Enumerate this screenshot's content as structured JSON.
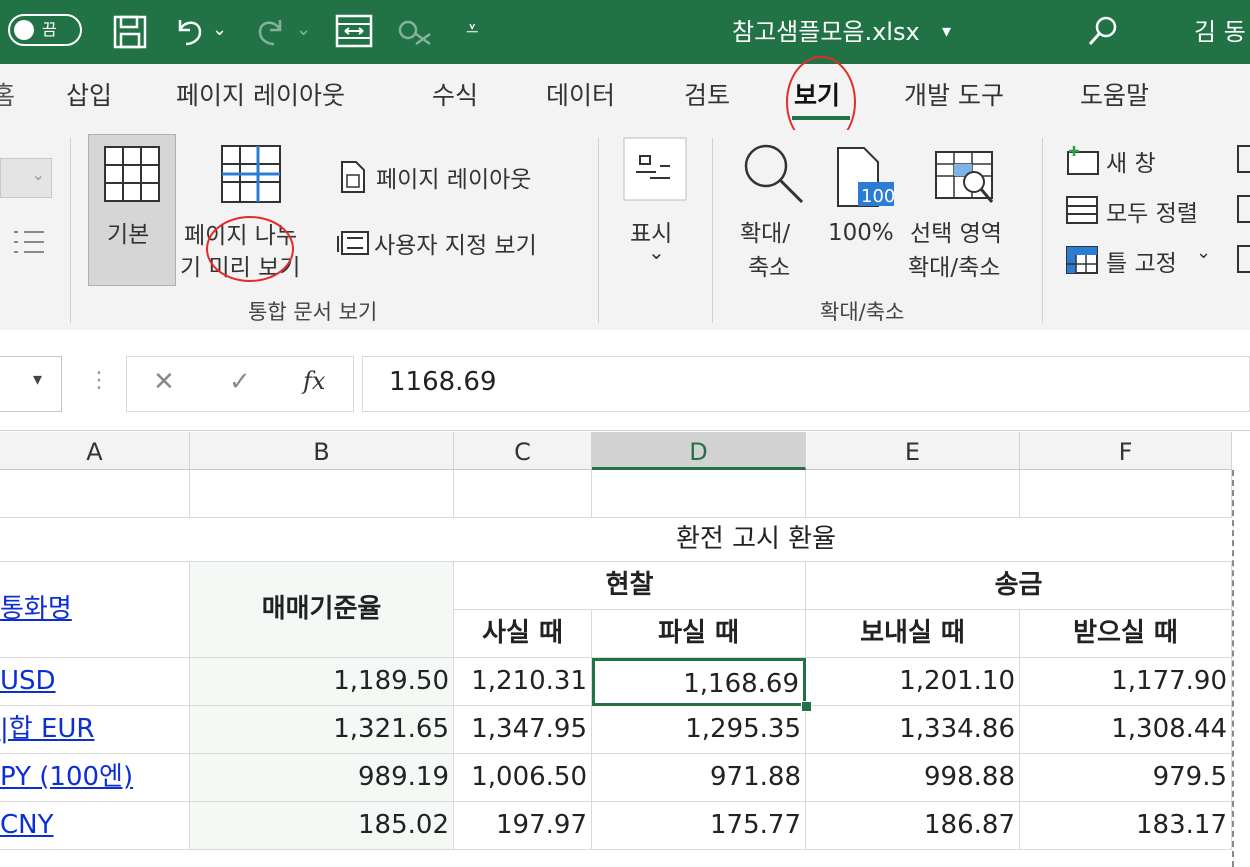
{
  "titlebar": {
    "autosave_label": "끔",
    "filename": "참고샘플모음.xlsx",
    "filename_caret": "▾",
    "user": "김 동"
  },
  "tabs": [
    {
      "label": "삽입"
    },
    {
      "label": "페이지 레이아웃"
    },
    {
      "label": "수식"
    },
    {
      "label": "데이터"
    },
    {
      "label": "검토"
    },
    {
      "label": "보기",
      "active": true
    },
    {
      "label": "개발 도구"
    },
    {
      "label": "도움말"
    }
  ],
  "ribbon": {
    "workbook_views": {
      "normal": "기본",
      "page_break_1": "페이지 나누",
      "page_break_2": "기 미리 보기",
      "page_layout": "페이지 레이아웃",
      "custom_views": "사용자 지정 보기",
      "group_label": "통합 문서 보기"
    },
    "show": {
      "label": "표시",
      "caret": "⌄"
    },
    "zoom": {
      "zoom_1": "확대/",
      "zoom_2": "축소",
      "zoom100": "100%",
      "zoom100_icon_text": "100",
      "selection_1": "선택 영역",
      "selection_2": "확대/축소",
      "group_label": "확대/축소"
    },
    "window": {
      "new_window": "새 창",
      "arrange_all": "모두 정렬",
      "freeze_panes": "틀 고정",
      "freeze_caret": "⌄"
    }
  },
  "formula_bar": {
    "cancel": "✕",
    "enter": "✓",
    "fx": "fx",
    "value": "1168.69"
  },
  "sheet": {
    "columns": [
      "A",
      "B",
      "C",
      "D",
      "E",
      "F"
    ],
    "selected_column": "D",
    "banner": "환전 고시 환율",
    "headers": {
      "currency": "통화명",
      "base_rate": "매매기준율",
      "cash": "현찰",
      "remit": "송금",
      "buy": "사실 때",
      "sell": "파실 때",
      "send": "보내실 때",
      "receive": "받으실 때"
    },
    "rows": [
      {
        "name": "USD",
        "b": "1,189.50",
        "c": "1,210.31",
        "d": "1,168.69",
        "e": "1,201.10",
        "f": "1,177.90"
      },
      {
        "name": "|합 EUR",
        "b": "1,321.65",
        "c": "1,347.95",
        "d": "1,295.35",
        "e": "1,334.86",
        "f": "1,308.44"
      },
      {
        "name": "PY (100엔)",
        "b": "989.19",
        "c": "1,006.50",
        "d": "971.88",
        "e": "998.88",
        "f": "979.5"
      },
      {
        "name": "CNY",
        "b": "185.02",
        "c": "197.97",
        "d": "175.77",
        "e": "186.87",
        "f": "183.17"
      }
    ]
  },
  "colors": {
    "accent": "#217346",
    "link": "#0b2fd4",
    "highlight_circle": "#e52b2b"
  }
}
